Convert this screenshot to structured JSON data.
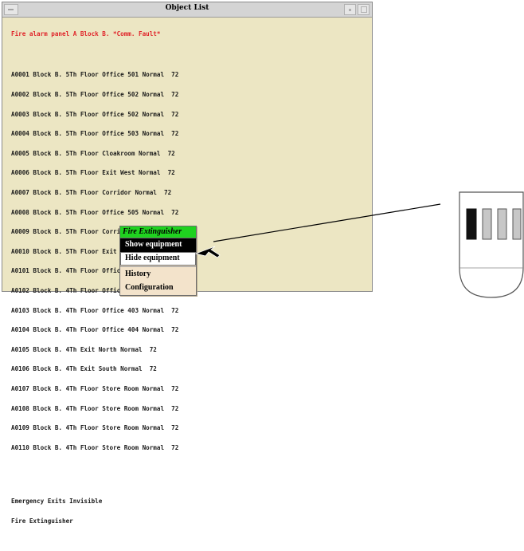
{
  "window": {
    "title": "Object List"
  },
  "alarm_text": "Fire alarm panel A Block B. *Comm. Fault*",
  "objects": [
    "A0001 Block B. 5Th Floor Office 501 Normal  72",
    "A0002 Block B. 5Th Floor Office 502 Normal  72",
    "A0003 Block B. 5Th Floor Office 502 Normal  72",
    "A0004 Block B. 5Th Floor Office 503 Normal  72",
    "A0005 Block B. 5Th Floor Cloakroom Normal  72",
    "A0006 Block B. 5Th Floor Exit West Normal  72",
    "A0007 Block B. 5Th Floor Corridor Normal  72",
    "A0008 Block B. 5Th Floor Office 505 Normal  72",
    "A0009 Block B. 5Th Floor Corridor Normal  72",
    "A0010 Block B. 5Th Floor Exit East Normal  72",
    "A0101 Block B. 4Th Floor Office 401 Normal  72",
    "A0102 Block B. 4Th Floor Office 402 Normal  72",
    "A0103 Block B. 4Th Floor Office 403 Normal  72",
    "A0104 Block B. 4Th Floor Office 404 Normal  72",
    "A0105 Block B. 4Th Exit North Normal  72",
    "A0106 Block B. 4Th Exit South Normal  72",
    "A0107 Block B. 4Th Floor Store Room Normal  72",
    "A0108 Block B. 4Th Floor Store Room Normal  72",
    "A0109 Block B. 4Th Floor Store Room Normal  72",
    "A0110 Block B. 4Th Floor Store Room Normal  72"
  ],
  "footer": {
    "emergency_exits": "Emergency Exits Invisible",
    "fire_extinguisher": "Fire Extinguisher"
  },
  "popup_menu": {
    "title": "Fire Extinguisher",
    "items": [
      "Show equipment",
      "Hide equipment",
      "History",
      "Configuration"
    ],
    "selected_index": 0
  },
  "colors": {
    "window_bg": "#ece6c3",
    "alarm": "#e0242a",
    "popup_title_bg": "#1fd21f",
    "popup_bg": "#f3e3cb"
  },
  "icons": {
    "pointer": "arrow-cursor-icon",
    "device": "extinguisher-panel-icon"
  }
}
